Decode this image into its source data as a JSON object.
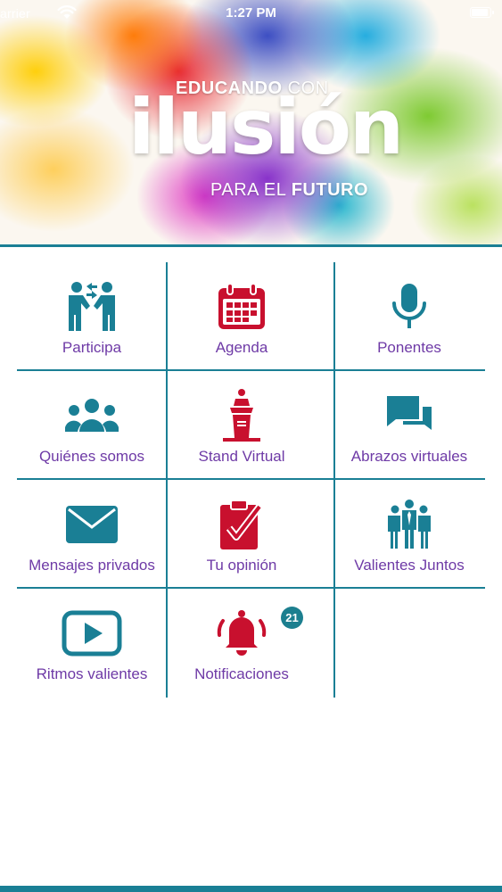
{
  "status_bar": {
    "carrier": "arrier",
    "time": "1:27 PM"
  },
  "logo": {
    "top_bold": "EDUCANDO",
    "top_light": "CON",
    "main": "ilusión",
    "bottom_light": "PARA EL",
    "bottom_bold": "FUTURO"
  },
  "colors": {
    "teal": "#1a7f95",
    "red": "#c8102e",
    "purple": "#6e3aa6"
  },
  "menu": [
    {
      "label": "Participa",
      "icon": "handshake-people-icon",
      "color": "teal"
    },
    {
      "label": "Agenda",
      "icon": "calendar-icon",
      "color": "red"
    },
    {
      "label": "Ponentes",
      "icon": "microphone-icon",
      "color": "teal"
    },
    {
      "label": "Quiénes somos",
      "icon": "group-icon",
      "color": "teal"
    },
    {
      "label": "Stand Virtual",
      "icon": "podium-icon",
      "color": "red"
    },
    {
      "label": "Abrazos virtuales",
      "icon": "chat-bubbles-icon",
      "color": "teal"
    },
    {
      "label": "Mensajes privados",
      "icon": "envelope-icon",
      "color": "teal"
    },
    {
      "label": "Tu opinión",
      "icon": "clipboard-check-icon",
      "color": "red"
    },
    {
      "label": "Valientes Juntos",
      "icon": "team-icon",
      "color": "teal"
    },
    {
      "label": "Ritmos valientes",
      "icon": "play-icon",
      "color": "teal"
    },
    {
      "label": "Notificaciones",
      "icon": "bell-icon",
      "color": "red",
      "badge": "21"
    }
  ]
}
